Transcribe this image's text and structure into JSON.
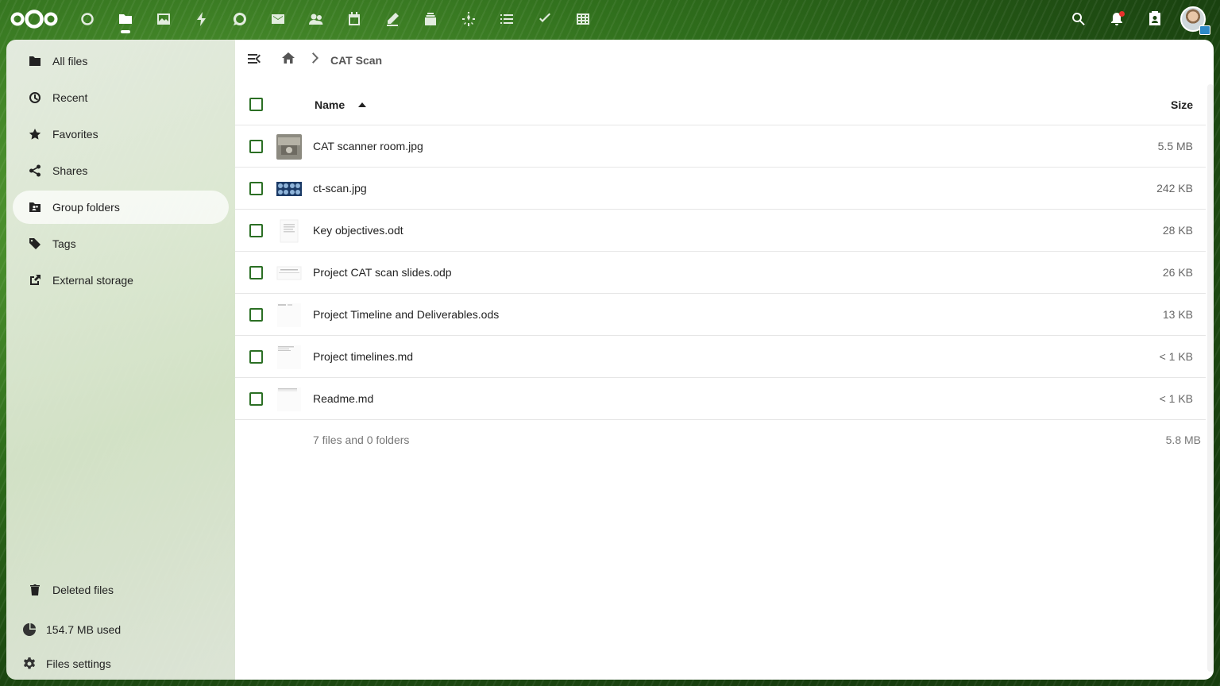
{
  "header": {
    "apps": [
      {
        "name": "dashboard-icon",
        "active": false
      },
      {
        "name": "files-icon",
        "active": true
      },
      {
        "name": "photos-icon",
        "active": false
      },
      {
        "name": "activity-icon",
        "active": false
      },
      {
        "name": "talk-icon",
        "active": false
      },
      {
        "name": "mail-icon",
        "active": false
      },
      {
        "name": "contacts-icon",
        "active": false
      },
      {
        "name": "calendar-icon",
        "active": false
      },
      {
        "name": "notes-icon",
        "active": false
      },
      {
        "name": "deck-icon",
        "active": false
      },
      {
        "name": "assistant-icon",
        "active": false
      },
      {
        "name": "list-icon",
        "active": false
      },
      {
        "name": "tasks-icon",
        "active": false
      },
      {
        "name": "tables-icon",
        "active": false
      }
    ]
  },
  "sidebar": {
    "items": [
      {
        "label": "All files",
        "icon": "folder-icon"
      },
      {
        "label": "Recent",
        "icon": "clock-icon"
      },
      {
        "label": "Favorites",
        "icon": "star-icon"
      },
      {
        "label": "Shares",
        "icon": "share-icon"
      },
      {
        "label": "Group folders",
        "icon": "group-folder-icon",
        "active": true
      },
      {
        "label": "Tags",
        "icon": "tag-icon"
      },
      {
        "label": "External storage",
        "icon": "external-storage-icon"
      }
    ],
    "deleted_files": "Deleted files",
    "storage_used": "154.7 MB used",
    "settings": "Files settings"
  },
  "breadcrumb": {
    "current": "CAT Scan"
  },
  "file_list": {
    "columns": {
      "name": "Name",
      "size": "Size"
    },
    "files": [
      {
        "name": "CAT scanner room.jpg",
        "size": "5.5 MB",
        "thumb": "photo"
      },
      {
        "name": "ct-scan.jpg",
        "size": "242 KB",
        "thumb": "ctscan"
      },
      {
        "name": "Key objectives.odt",
        "size": "28 KB",
        "thumb": "doc"
      },
      {
        "name": "Project CAT scan slides.odp",
        "size": "26 KB",
        "thumb": "slides"
      },
      {
        "name": "Project Timeline and Deliverables.ods",
        "size": "13 KB",
        "thumb": "sheet"
      },
      {
        "name": "Project timelines.md",
        "size": "< 1 KB",
        "thumb": "text"
      },
      {
        "name": "Readme.md",
        "size": "< 1 KB",
        "thumb": "text2"
      }
    ],
    "summary": {
      "text": "7 files and 0 folders",
      "size": "5.8 MB"
    }
  },
  "colors": {
    "checkbox_border": "#2b6f24",
    "active_nav_bg": "#ffffff"
  }
}
